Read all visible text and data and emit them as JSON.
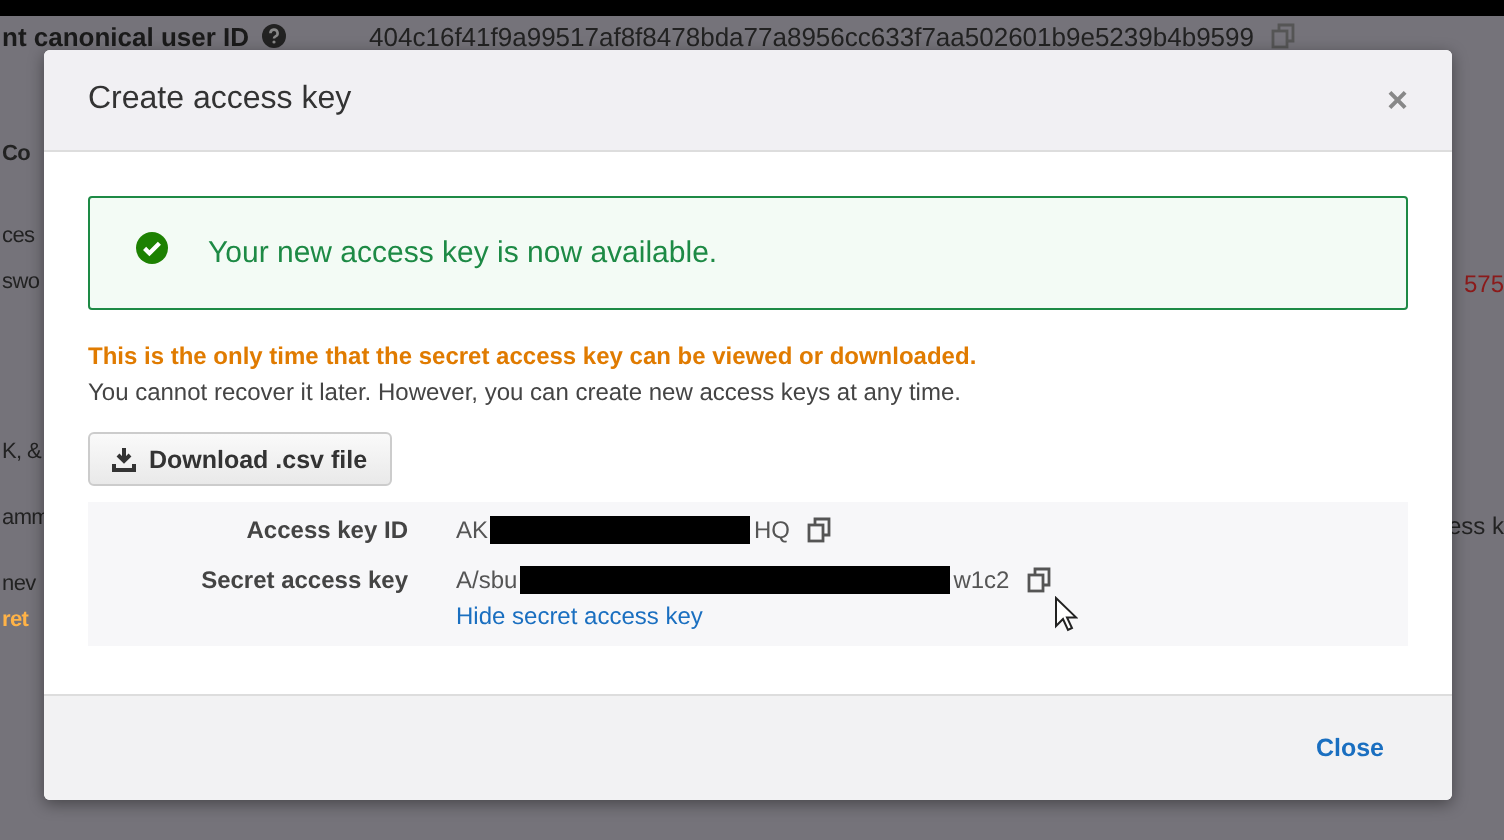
{
  "background_page": {
    "canonical_id": {
      "label": "nt canonical user ID",
      "value": "404c16f41f9a99517af8f8478bda77a8956cc633f7aa502601b9e5239b4b9599"
    },
    "left_fragments": [
      {
        "text": "Co",
        "kind": "bold"
      },
      {
        "text": "ces",
        "kind": "plain"
      },
      {
        "text": "swo",
        "kind": "plain"
      },
      {
        "text": "K, &",
        "kind": "plain"
      },
      {
        "text": "amm",
        "kind": "plain"
      },
      {
        "text": "nev",
        "kind": "plain"
      },
      {
        "text": "ret",
        "kind": "warning"
      }
    ],
    "right_fragments": [
      {
        "text": "575",
        "kind": "danger"
      },
      {
        "text": "ess k",
        "kind": "plain"
      }
    ]
  },
  "dialog": {
    "title": "Create access key",
    "close_glyph": "×",
    "success_message": "Your new access key is now available.",
    "warning": "This is the only time that the secret access key can be viewed or downloaded.",
    "note": "You cannot recover it later. However, you can create new access keys at any time.",
    "download_button": "Download .csv file",
    "fields": [
      {
        "label": "Access key ID",
        "value_start": "AK",
        "value_end": "HQ",
        "redacted": true
      },
      {
        "label": "Secret access key",
        "value_start": "A/sbu",
        "value_end": "w1c2",
        "redacted": true,
        "link": "Hide secret access key"
      }
    ],
    "footer_button": "Close"
  }
}
